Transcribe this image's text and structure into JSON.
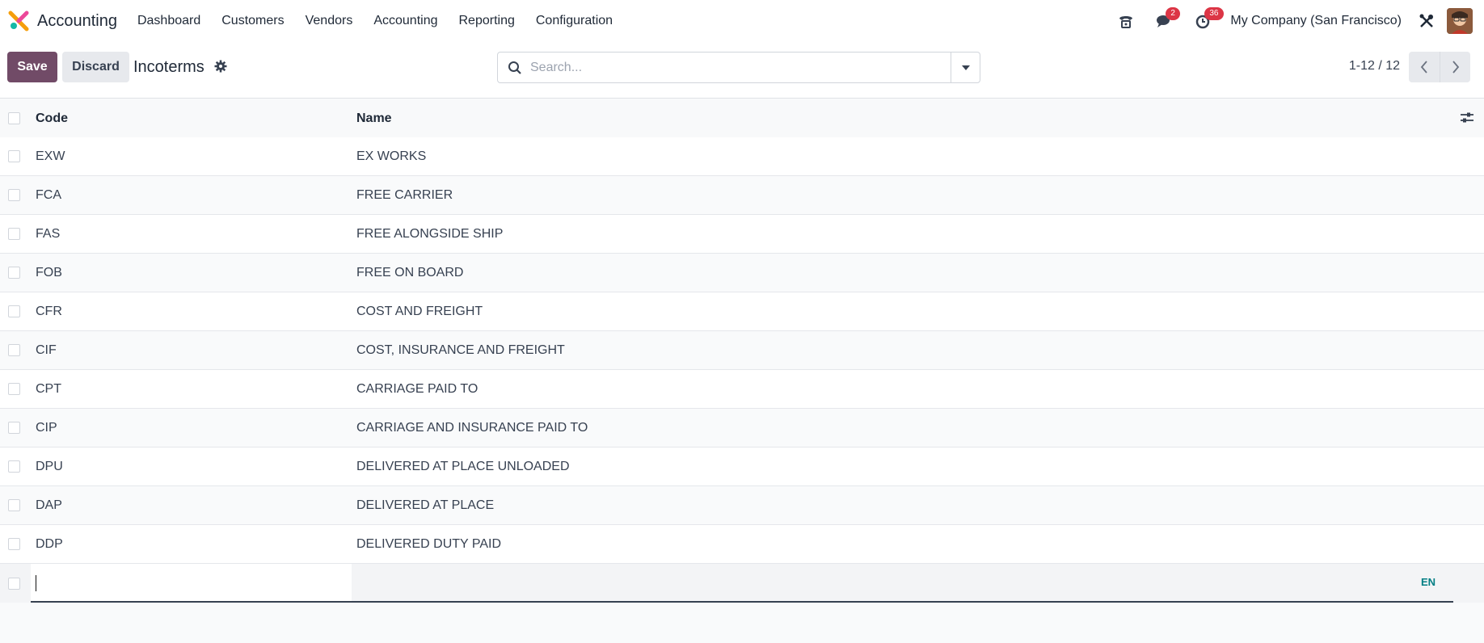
{
  "app": {
    "name": "Accounting"
  },
  "menu": [
    "Dashboard",
    "Customers",
    "Vendors",
    "Accounting",
    "Reporting",
    "Configuration"
  ],
  "nav": {
    "messages_badge": "2",
    "activities_badge": "36",
    "company": "My Company (San Francisco)"
  },
  "control": {
    "save_label": "Save",
    "discard_label": "Discard",
    "title": "Incoterms",
    "search_placeholder": "Search...",
    "pager": "1-12 / 12"
  },
  "table": {
    "headers": {
      "code": "Code",
      "name": "Name"
    },
    "rows": [
      {
        "code": "EXW",
        "name": "EX WORKS"
      },
      {
        "code": "FCA",
        "name": "FREE CARRIER"
      },
      {
        "code": "FAS",
        "name": "FREE ALONGSIDE SHIP"
      },
      {
        "code": "FOB",
        "name": "FREE ON BOARD"
      },
      {
        "code": "CFR",
        "name": "COST AND FREIGHT"
      },
      {
        "code": "CIF",
        "name": "COST, INSURANCE AND FREIGHT"
      },
      {
        "code": "CPT",
        "name": "CARRIAGE PAID TO"
      },
      {
        "code": "CIP",
        "name": "CARRIAGE AND INSURANCE PAID TO"
      },
      {
        "code": "DPU",
        "name": "DELIVERED AT PLACE UNLOADED"
      },
      {
        "code": "DAP",
        "name": "DELIVERED AT PLACE"
      },
      {
        "code": "DDP",
        "name": "DELIVERED DUTY PAID"
      }
    ],
    "new_row": {
      "code_value": "",
      "lang": "EN"
    }
  },
  "colors": {
    "primary": "#714b67",
    "badge": "#dc3545",
    "lang": "#017e84"
  }
}
